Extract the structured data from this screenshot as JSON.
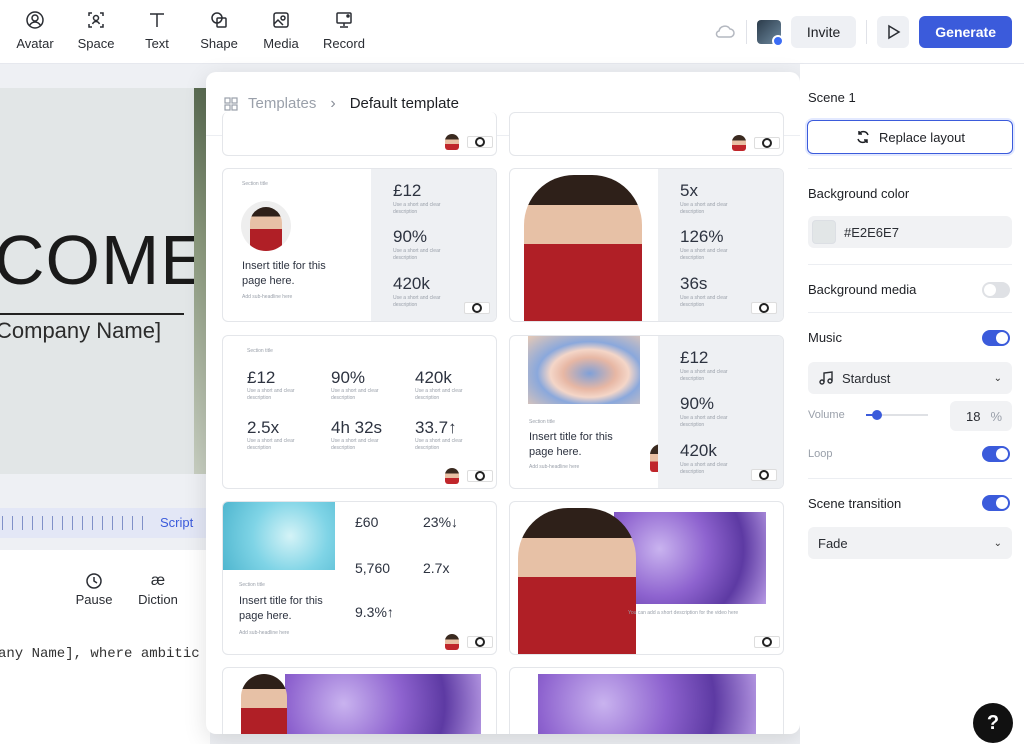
{
  "toolbar": {
    "tools": [
      {
        "label": "Avatar",
        "icon": "avatar-icon"
      },
      {
        "label": "Space",
        "icon": "space-icon"
      },
      {
        "label": "Text",
        "icon": "text-icon"
      },
      {
        "label": "Shape",
        "icon": "shape-icon"
      },
      {
        "label": "Media",
        "icon": "media-icon"
      },
      {
        "label": "Record",
        "icon": "record-icon"
      }
    ],
    "invite_label": "Invite",
    "generate_label": "Generate",
    "accent": "#3B5BDB"
  },
  "canvas": {
    "headline": "COME",
    "company": "Company Name]",
    "background": "#E2E6E7"
  },
  "timeline": {
    "script_label": "Script"
  },
  "controls": [
    {
      "label": "Pause",
      "icon": "clock-icon"
    },
    {
      "label": "Diction",
      "icon": "ae-ligature-icon"
    }
  ],
  "script_text": "any Name], where ambitic",
  "templates_panel": {
    "breadcrumb_root": "Templates",
    "breadcrumb_current": "Default template",
    "card1": {
      "section": "Section title",
      "title": "Insert title for this page here.",
      "sub": "Add sub-headline here",
      "stats": [
        "£12",
        "90%",
        "420k"
      ],
      "desc": "Use a short and clear description"
    },
    "card2": {
      "stats": [
        "5x",
        "126%",
        "36s"
      ],
      "desc": "Use a short and clear description"
    },
    "card3": {
      "section": "Section title",
      "stats": [
        "£12",
        "90%",
        "420k",
        "2.5x",
        "4h 32s",
        "33.7↑"
      ],
      "desc": "Use a short and clear description"
    },
    "card4": {
      "section": "Section title",
      "title": "Insert title for this page here.",
      "sub": "Add sub-headline here",
      "stats": [
        "£12",
        "90%",
        "420k"
      ],
      "desc": "Use a short and clear description"
    },
    "card5": {
      "section": "Section title",
      "title": "Insert title for this page here.",
      "sub": "Add sub-headline here",
      "stats": [
        "£60",
        "23%↓",
        "5,760",
        "2.7x",
        "9.3%↑"
      ],
      "desc": "Use a short and clear description"
    },
    "card6": {
      "caption": "You can add a short description for the video here"
    }
  },
  "side_panel": {
    "scene_title": "Scene 1",
    "replace_label": "Replace layout",
    "bg_color_label": "Background color",
    "bg_color_value": "#E2E6E7",
    "bg_media_label": "Background media",
    "bg_media_on": false,
    "music_label": "Music",
    "music_on": true,
    "music_track": "Stardust",
    "volume_label": "Volume",
    "volume_value": "18",
    "volume_unit": "%",
    "loop_label": "Loop",
    "loop_on": true,
    "transition_label": "Scene transition",
    "transition_on": true,
    "transition_value": "Fade"
  },
  "help_label": "?"
}
